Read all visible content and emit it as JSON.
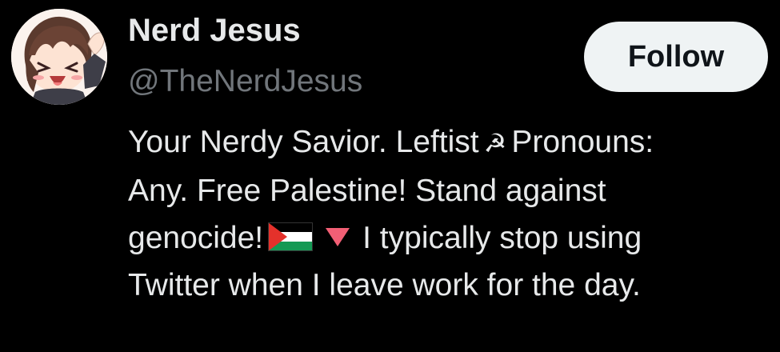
{
  "profile": {
    "display_name": "Nerd Jesus",
    "handle": "@TheNerdJesus",
    "follow_label": "Follow",
    "bio": {
      "line1": "Your Nerdy Savior. Leftist",
      "line1_after": "Pronouns:",
      "sickle_symbol": "☭",
      "line2": "Any. Free Palestine! Stand against",
      "line3_before": "genocide!",
      "line3_after": "I typically stop using",
      "line4": "Twitter when I leave work for the day.",
      "emojis": [
        "palestine-flag",
        "red-downward-triangle"
      ]
    }
  },
  "colors": {
    "background": "#000000",
    "primary_text": "#e7e9ea",
    "secondary_text": "#71767b",
    "follow_bg": "#eff3f4",
    "follow_text": "#0f1419",
    "flag_black": "#000000",
    "flag_white": "#ffffff",
    "flag_green": "#149954",
    "flag_red": "#e4312b",
    "triangle": "#f25f75"
  }
}
